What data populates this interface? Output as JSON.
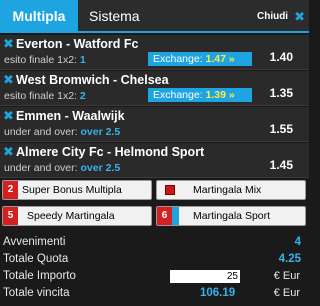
{
  "tabs": {
    "multipla": "Multipla",
    "sistema": "Sistema"
  },
  "close": {
    "label": "Chiudi",
    "icon": "close-icon"
  },
  "bets": [
    {
      "title": "Everton - Watford Fc",
      "market": "esito finale 1x2:",
      "choice": "1",
      "exchange_label": "Exchange:",
      "exchange_value": "1.47 »",
      "odd": "1.40"
    },
    {
      "title": "West Bromwich - Chelsea",
      "market": "esito finale 1x2:",
      "choice": "2",
      "exchange_label": "Exchange:",
      "exchange_value": "1.39 »",
      "odd": "1.35"
    },
    {
      "title": "Emmen - Waalwijk",
      "market": "under and over:",
      "choice": "over 2.5",
      "odd": "1.55"
    },
    {
      "title": "Almere City Fc - Helmond Sport",
      "market": "under and over:",
      "choice": "over 2.5",
      "odd": "1.45"
    }
  ],
  "buttons": {
    "super_bonus": {
      "badge": "2",
      "label": "Super Bonus Multipla"
    },
    "martingala_mix": {
      "label": "Martingala Mix"
    },
    "speedy": {
      "badge": "5",
      "label": "Speedy Martingala"
    },
    "martingala_sport": {
      "badge": "6",
      "label": "Martingala Sport"
    }
  },
  "summary": {
    "avvenimenti_label": "Avvenimenti",
    "avvenimenti_value": "4",
    "quota_label": "Totale Quota",
    "quota_value": "4.25",
    "importo_label": "Totale Importo",
    "importo_value": "25",
    "importo_currency": "€ Eur",
    "vincita_label": "Totale vincita",
    "vincita_value": "106.19",
    "vincita_currency": "€ Eur"
  },
  "colors": {
    "accent": "#1ea4e0",
    "badge": "#d42020",
    "highlight": "#ffe94a"
  }
}
